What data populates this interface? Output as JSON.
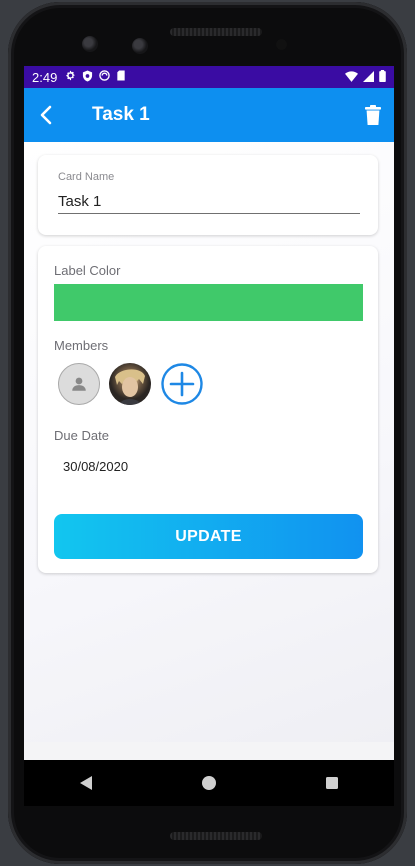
{
  "status_bar": {
    "time": "2:49",
    "icons": [
      "gear-icon",
      "shield-icon",
      "sync-icon",
      "sd-card-icon"
    ],
    "right_icons": [
      "wifi-icon",
      "signal-icon",
      "battery-icon"
    ]
  },
  "app_bar": {
    "title": "Task 1",
    "back_icon": "back-arrow-icon",
    "delete_icon": "trash-icon",
    "color": "#0d8ff0"
  },
  "card_name": {
    "label": "Card Name",
    "value": "Task 1"
  },
  "label_color": {
    "label": "Label Color",
    "color": "#40c96a"
  },
  "members": {
    "label": "Members",
    "avatars": [
      "default-avatar",
      "photo-avatar"
    ],
    "add_icon": "add-circle-icon"
  },
  "due_date": {
    "label": "Due Date",
    "value": "30/08/2020"
  },
  "update_button": {
    "label": "UPDATE"
  },
  "nav_bar": {
    "buttons": [
      "back-triangle-icon",
      "home-circle-icon",
      "recents-square-icon"
    ]
  }
}
